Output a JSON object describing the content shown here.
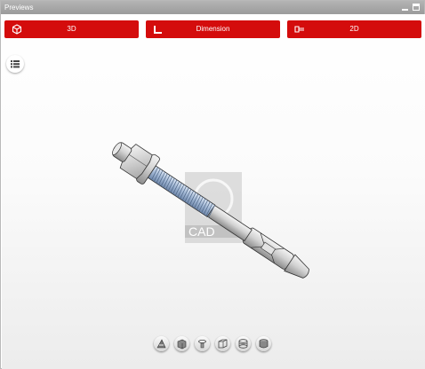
{
  "window": {
    "title": "Previews"
  },
  "toolbar": {
    "btn_3d": "3D",
    "btn_dimension": "Dimension",
    "btn_2d": "2D"
  },
  "colors": {
    "accent": "#d40c0c",
    "titlebar": "#a8a8a8"
  },
  "watermark": {
    "text": "CAD"
  },
  "icons": [
    "cube-icon",
    "dimension-icon",
    "drawing-2d-icon",
    "list-icon",
    "perspective-view-icon",
    "front-view-icon",
    "top-view-icon",
    "side-view-icon",
    "section-view-icon",
    "iso-view-icon"
  ]
}
